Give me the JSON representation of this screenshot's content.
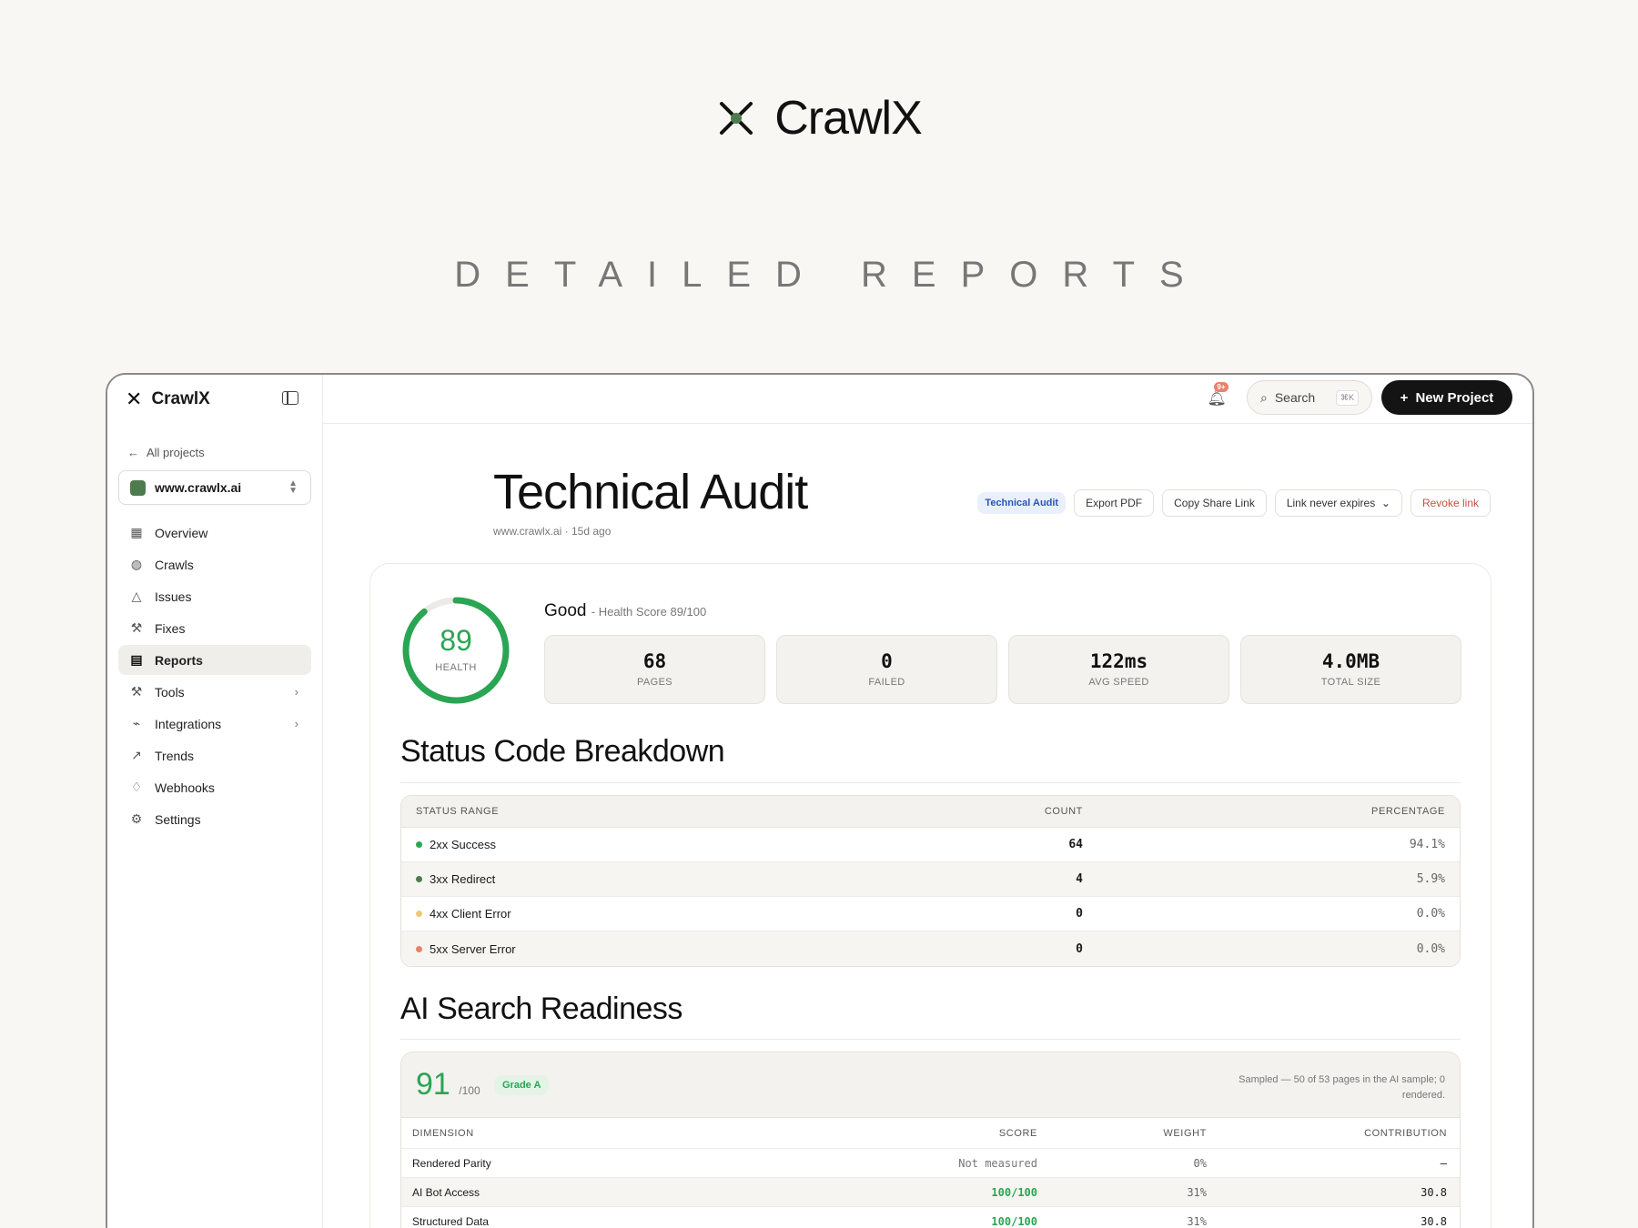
{
  "hero": {
    "brand": "CrawlX",
    "tagline": "DETAILED REPORTS"
  },
  "sidebar": {
    "brand": "CrawlX",
    "back_label": "All projects",
    "project": "www.crawlx.ai",
    "items": [
      {
        "label": "Overview",
        "icon": "grid-icon"
      },
      {
        "label": "Crawls",
        "icon": "globe-icon"
      },
      {
        "label": "Issues",
        "icon": "warning-icon"
      },
      {
        "label": "Fixes",
        "icon": "wrench-icon"
      },
      {
        "label": "Reports",
        "icon": "document-icon",
        "active": true
      },
      {
        "label": "Tools",
        "icon": "tool-icon",
        "chevron": true
      },
      {
        "label": "Integrations",
        "icon": "plug-icon",
        "chevron": true
      },
      {
        "label": "Trends",
        "icon": "trend-icon"
      },
      {
        "label": "Webhooks",
        "icon": "bell-icon"
      },
      {
        "label": "Settings",
        "icon": "gear-icon"
      }
    ]
  },
  "topbar": {
    "notification_badge": "9+",
    "search_label": "Search",
    "search_shortcut": "⌘K",
    "new_project_label": "New Project"
  },
  "report": {
    "title": "Technical Audit",
    "subtitle": "www.crawlx.ai · 15d ago",
    "actions": {
      "tag": "Technical Audit",
      "export": "Export PDF",
      "copy_link": "Copy Share Link",
      "expiry": "Link never expires",
      "revoke": "Revoke link"
    },
    "health": {
      "score": "89",
      "score_value": 89,
      "label": "HEALTH",
      "grade": "Good",
      "grade_detail": "- Health Score 89/100"
    },
    "stats": [
      {
        "value": "68",
        "label": "PAGES"
      },
      {
        "value": "0",
        "label": "FAILED"
      },
      {
        "value": "122ms",
        "label": "AVG SPEED"
      },
      {
        "value": "4.0MB",
        "label": "TOTAL SIZE"
      }
    ],
    "status_section": {
      "title": "Status Code Breakdown",
      "headers": [
        "STATUS RANGE",
        "COUNT",
        "PERCENTAGE"
      ],
      "rows": [
        {
          "label": "2xx Success",
          "count": "64",
          "pct": "94.1%",
          "color": "#2aa553"
        },
        {
          "label": "3xx Redirect",
          "count": "4",
          "pct": "5.9%",
          "color": "#4e7b4e"
        },
        {
          "label": "4xx Client Error",
          "count": "0",
          "pct": "0.0%",
          "color": "#f0c875"
        },
        {
          "label": "5xx Server Error",
          "count": "0",
          "pct": "0.0%",
          "color": "#e8826b"
        }
      ]
    },
    "ai_section": {
      "title": "AI Search Readiness",
      "score": "91",
      "score_max": "/100",
      "grade": "Grade A",
      "note": "Sampled — 50 of 53 pages in the AI sample; 0 rendered.",
      "headers": [
        "DIMENSION",
        "SCORE",
        "WEIGHT",
        "CONTRIBUTION"
      ],
      "rows": [
        {
          "dimension": "Rendered Parity",
          "score": "Not measured",
          "weight": "0%",
          "contribution": "—"
        },
        {
          "dimension": "AI Bot Access",
          "score": "100/100",
          "weight": "31%",
          "contribution": "30.8"
        },
        {
          "dimension": "Structured Data",
          "score": "100/100",
          "weight": "31%",
          "contribution": "30.8"
        }
      ]
    }
  }
}
